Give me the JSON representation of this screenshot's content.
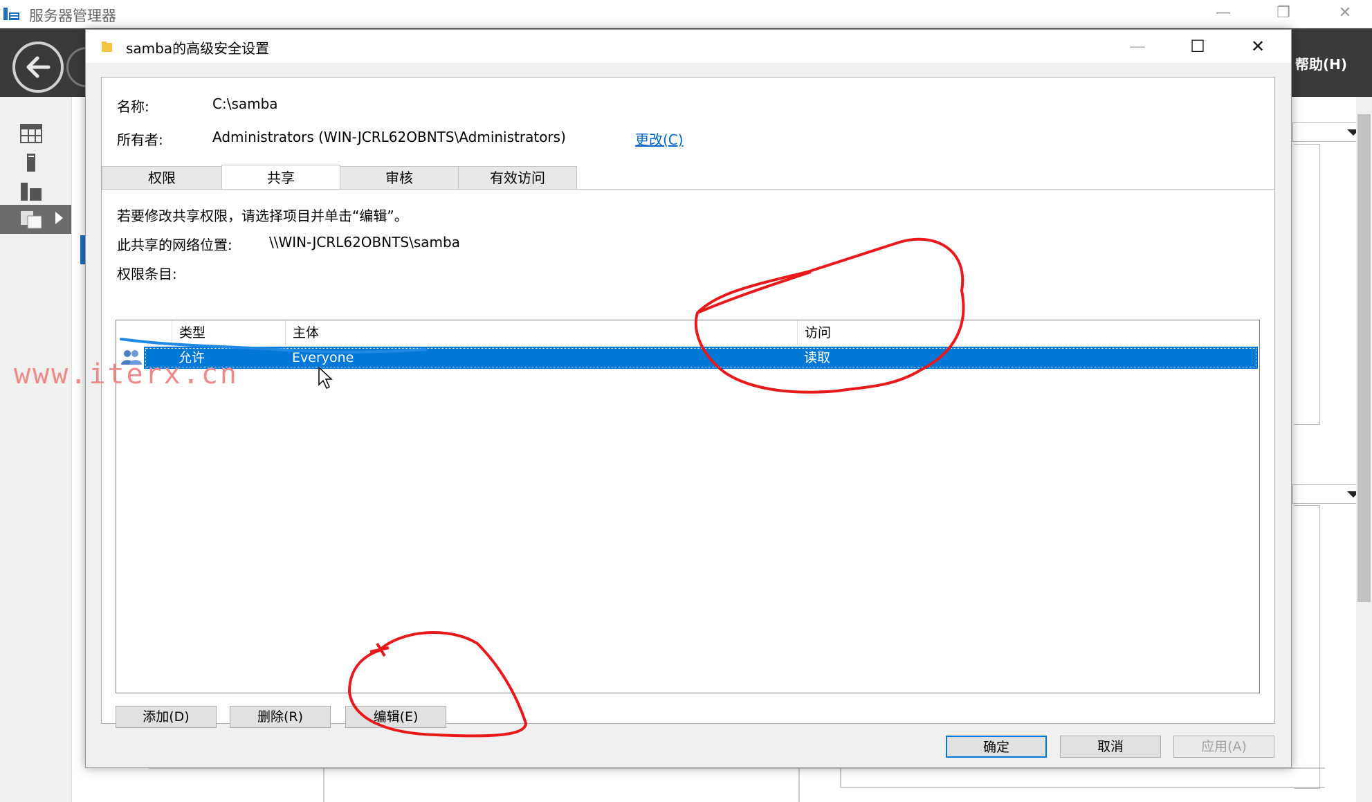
{
  "background_window": {
    "title": "服务器管理器",
    "help_menu": "帮助(H)"
  },
  "dialog": {
    "title": "samba的高级安全设置",
    "name_label": "名称:",
    "name_value": "C:\\samba",
    "owner_label": "所有者:",
    "owner_value": "Administrators (WIN-JCRL62OBNTS\\Administrators)",
    "owner_change_link": "更改(C)",
    "tabs": [
      {
        "label": "权限",
        "active": false
      },
      {
        "label": "共享",
        "active": true
      },
      {
        "label": "审核",
        "active": false
      },
      {
        "label": "有效访问",
        "active": false
      }
    ],
    "instruction": "若要修改共享权限，请选择项目并单击“编辑”。",
    "network_location_label": "此共享的网络位置:",
    "network_location_value": "\\\\WIN-JCRL62OBNTS\\samba",
    "entries_label": "权限条目:",
    "columns": [
      "类型",
      "主体",
      "访问"
    ],
    "rows": [
      {
        "type": "允许",
        "principal": "Everyone",
        "access": "读取",
        "selected": true
      }
    ],
    "buttons": {
      "add": "添加(D)",
      "remove": "删除(R)",
      "edit": "编辑(E)",
      "ok": "确定",
      "cancel": "取消",
      "apply": "应用(A)"
    }
  },
  "watermark": "www.iterx.cn",
  "colors": {
    "selection": "#0078d7",
    "link": "#0066cc",
    "annotation_red": "#e8191b",
    "annotation_blue": "#1e88e5",
    "header_dark": "#3a3a3a"
  },
  "icons": [
    "app-server-manager-icon",
    "back-arrow-icon",
    "folder-icon",
    "users-group-icon",
    "mouse-pointer-icon"
  ]
}
